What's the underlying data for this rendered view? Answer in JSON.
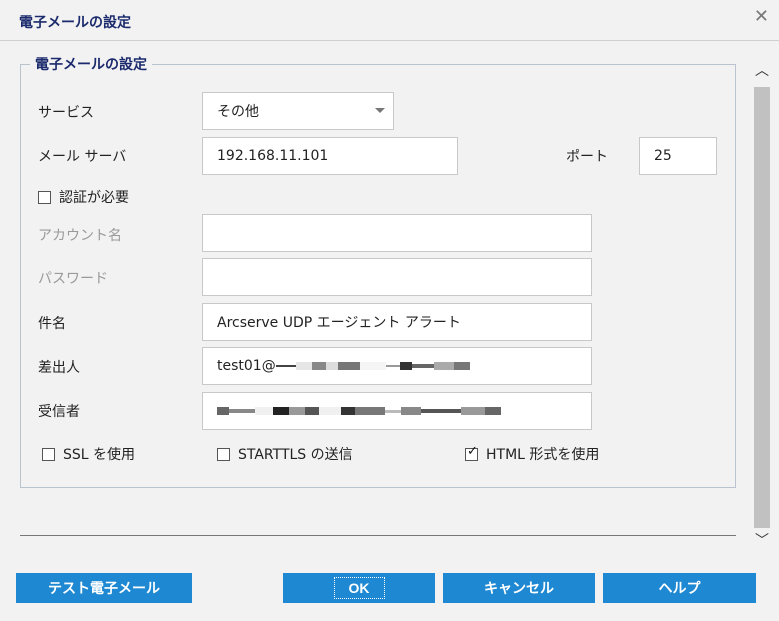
{
  "dialog": {
    "title": "電子メールの設定"
  },
  "fieldset": {
    "legend": "電子メールの設定"
  },
  "form": {
    "service": {
      "label": "サービス",
      "value": "その他"
    },
    "mail_server": {
      "label": "メール サーバ",
      "value": "192.168.11.101"
    },
    "port": {
      "label": "ポート",
      "value": "25"
    },
    "auth_required": {
      "label": "認証が必要",
      "checked": false
    },
    "account_name": {
      "label": "アカウント名",
      "value": ""
    },
    "password": {
      "label": "パスワード",
      "value": ""
    },
    "subject": {
      "label": "件名",
      "value": "Arcserve UDP エージェント アラート"
    },
    "sender": {
      "label": "差出人",
      "value": "test01@"
    },
    "recipients": {
      "label": "受信者"
    },
    "use_ssl": {
      "label": "SSL を使用",
      "checked": false
    },
    "starttls": {
      "label": "STARTTLS の送信",
      "checked": false
    },
    "html_format": {
      "label": "HTML 形式を使用",
      "checked": true
    }
  },
  "buttons": {
    "test_email": "テスト電子メール",
    "ok": "OK",
    "cancel": "キャンセル",
    "help": "ヘルプ"
  },
  "icons": {
    "close": "close-icon",
    "scroll_up": "chevron-up-icon",
    "scroll_down": "chevron-down-icon"
  },
  "colors": {
    "accent": "#1e88d2",
    "title": "#1a2a6c"
  }
}
